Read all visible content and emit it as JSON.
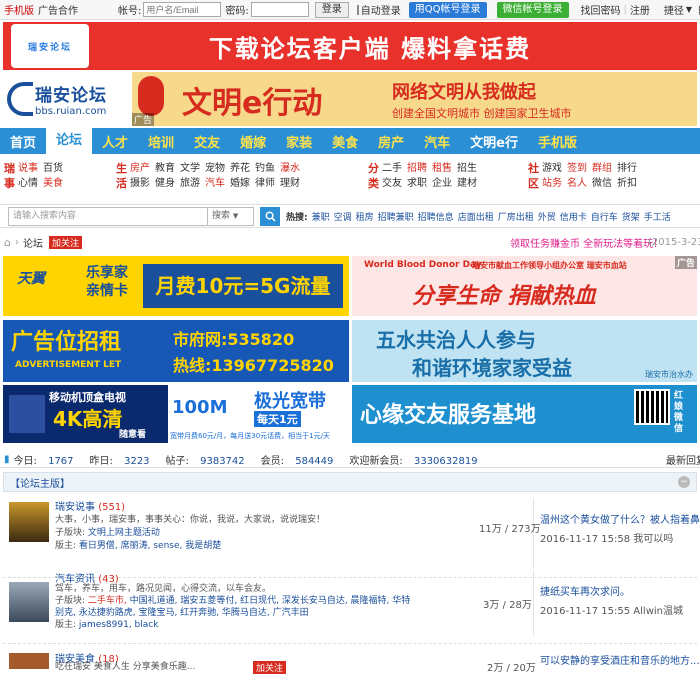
{
  "topbar": {
    "mobile": "手机版",
    "ad_coop": "广告合作",
    "account_label": "帐号:",
    "account_placeholder": "用户名/Email",
    "password_label": "密码:",
    "login": "登录",
    "auto_login": "自动登录",
    "qq_login": "用QQ帐号登录",
    "wechat_login": "微信帐号登录",
    "find_password": "找回密码",
    "register": "注册",
    "quick_nav": "捷径"
  },
  "top_ad": {
    "text": "下载论坛客户端  爆料拿话费",
    "phone": "瑞安论坛"
  },
  "logo": {
    "name": "瑞安论坛",
    "domain": "bbs.ruian.com"
  },
  "civil_ad": {
    "title": "文明e行动",
    "slogan": "网络文明从我做起",
    "sub": "创建全国文明城市  创建国家卫生城市",
    "tag": "广告"
  },
  "nav": [
    {
      "label": "首页",
      "style": "normal"
    },
    {
      "label": "论坛",
      "style": "active"
    },
    {
      "label": "人才",
      "style": "yellow"
    },
    {
      "label": "培训",
      "style": "yellow"
    },
    {
      "label": "交友",
      "style": "yellow"
    },
    {
      "label": "婚嫁",
      "style": "yellow"
    },
    {
      "label": "家装",
      "style": "yellow"
    },
    {
      "label": "美食",
      "style": "yellow"
    },
    {
      "label": "房产",
      "style": "yellow"
    },
    {
      "label": "汽车",
      "style": "yellow"
    },
    {
      "label": "文明e行",
      "style": "normal"
    },
    {
      "label": "手机版",
      "style": "yellow"
    }
  ],
  "subnav": [
    {
      "head": "瑞事",
      "items": [
        {
          "t": "说事",
          "r": true
        },
        {
          "t": "心情",
          "r": false
        },
        {
          "t": "百货",
          "r": false
        },
        {
          "t": "美食",
          "r": true
        }
      ]
    },
    {
      "head": "生活",
      "items": [
        {
          "t": "房产",
          "r": true
        },
        {
          "t": "摄影",
          "r": false
        },
        {
          "t": "教育",
          "r": false
        },
        {
          "t": "健身",
          "r": false
        },
        {
          "t": "文学",
          "r": false
        },
        {
          "t": "旅游",
          "r": false
        },
        {
          "t": "宠物",
          "r": false
        },
        {
          "t": "汽车",
          "r": true
        },
        {
          "t": "养花",
          "r": false
        },
        {
          "t": "婚嫁",
          "r": false
        },
        {
          "t": "钓鱼",
          "r": false
        },
        {
          "t": "律师",
          "r": false
        },
        {
          "t": "瀑水",
          "r": true
        },
        {
          "t": "理财",
          "r": false
        }
      ]
    },
    {
      "head": "分类",
      "items": [
        {
          "t": "二手",
          "r": false
        },
        {
          "t": "交友",
          "r": false
        },
        {
          "t": "招聘",
          "r": true
        },
        {
          "t": "求职",
          "r": false
        },
        {
          "t": "租售",
          "r": true
        },
        {
          "t": "企业",
          "r": false
        },
        {
          "t": "招生",
          "r": false
        },
        {
          "t": "建材",
          "r": false
        }
      ]
    },
    {
      "head": "社区",
      "items": [
        {
          "t": "游戏",
          "r": false
        },
        {
          "t": "站务",
          "r": true
        },
        {
          "t": "签到",
          "r": true
        },
        {
          "t": "名人",
          "r": true
        },
        {
          "t": "群组",
          "r": true
        },
        {
          "t": "微信",
          "r": false
        },
        {
          "t": "排行",
          "r": false
        },
        {
          "t": "折扣",
          "r": false
        }
      ]
    }
  ],
  "search": {
    "placeholder": "请输入搜索内容",
    "select": "搜索",
    "hot_label": "热搜:",
    "hot_words": [
      "兼职",
      "空调",
      "租房",
      "招聘兼职",
      "招聘信息",
      "店面出租",
      "厂房出租",
      "外贸",
      "信用卡",
      "自行车",
      "货架",
      "手工活"
    ]
  },
  "crumb": {
    "label": "论坛",
    "follow": "加关注",
    "promo": "领取任务赚金币 全新玩法等着玩！",
    "date": "(2015-3-23)"
  },
  "banners": {
    "tianyi": {
      "brand": "天翼",
      "product": "乐享家 亲情卡",
      "price": "月费10元=5G流量"
    },
    "blood": {
      "title": "World Blood Donor Day",
      "org": "瑞安市献血工作领导小组办公室  瑞安市血站",
      "slogan": "分享生命 捐献热血",
      "tag": "广告"
    },
    "adrent": {
      "title": "广告位招租",
      "sub": "ADVERTISEMENT LET",
      "site": "市府网:535820",
      "hotline": "热线:13967725820"
    },
    "water": {
      "line1": "五水共治人人参与",
      "line2": "和谐环境家家受益",
      "org": "瑞安市治水办"
    },
    "tv": {
      "title": "移动机顶盒电视",
      "big": "4K高清",
      "sub": "随意看"
    },
    "broadband": {
      "speed": "100M",
      "name": "极光宽带",
      "daily": "每天1元",
      "fine": "宽带月费60元/月，每月送30元话费，相当于1元/天"
    },
    "dating": {
      "text": "心缘交友服务基地",
      "qr": "红娘微信"
    }
  },
  "stats": {
    "today_label": "今日:",
    "today": "1767",
    "yesterday_label": "昨日:",
    "yesterday": "3223",
    "posts_label": "帖子:",
    "posts": "9383742",
    "members_label": "会员:",
    "members": "584449",
    "welcome_label": "欢迎新会员:",
    "welcome": "3330632819",
    "latest": "最新回复"
  },
  "section": {
    "title": "【论坛主版】"
  },
  "forums": [
    {
      "name": "瑞安说事",
      "count": "(551)",
      "desc": "大事，小事，瑞安事，事事关心：你说，我说，大家说，说说瑞安！",
      "sub_label": "子版块:",
      "sub": "文明上网主题活动",
      "mod_label": "版主:",
      "mods": "看日男僧, 席丽涛, sense, 我是胡楚",
      "stats": "11万 / 273万",
      "last_title": "温州这个黄女做了什么？被人指着鼻...",
      "last_time": "2016-11-17 15:58 我可以吗"
    },
    {
      "name": "汽车资讯",
      "count": "(43)",
      "desc": "驾车，养车，用车，路况见闻，心得交流，以车会友。",
      "sub_label": "子版块:",
      "sub_red": "二手车市,",
      "sub": "中国礼道通, 瑞安五菱等付, 红日现代, 深发长安马自达, 晨隆福特, 华特别克, 永达捷豹路虎, 宝隆宝马, 红开奔驰, 华腾马自达, 广汽丰田",
      "mod_label": "版主:",
      "mods": "james8991, black",
      "stats": "3万 / 28万",
      "last_title": "捷纸买车再次求问。",
      "last_time": "2016-11-17 15:55 Allwin温城"
    },
    {
      "name": "瑞安美食",
      "count": "(18)",
      "desc": "吃在瑞安 美食人生 分享美食乐趣...",
      "follow": "加关注",
      "stats": "2万 / 20万",
      "last_title": "可以安静的享受酒庄和音乐的地方..."
    }
  ]
}
